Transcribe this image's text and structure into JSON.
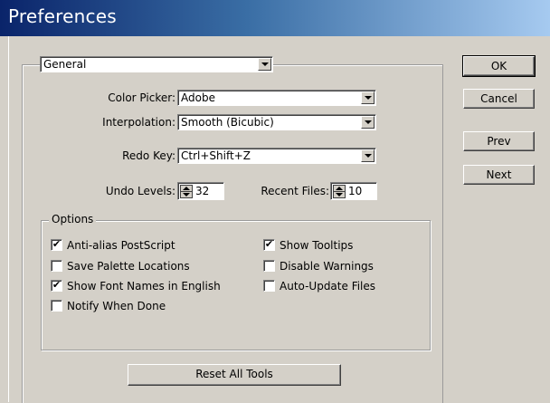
{
  "window": {
    "title": "Preferences"
  },
  "panel_select": {
    "value": "General"
  },
  "fields": {
    "color_picker": {
      "label": "Color Picker:",
      "value": "Adobe"
    },
    "interpolation": {
      "label": "Interpolation:",
      "value": "Smooth (Bicubic)"
    },
    "redo_key": {
      "label": "Redo Key:",
      "value": "Ctrl+Shift+Z"
    },
    "undo_levels": {
      "label": "Undo Levels:",
      "value": "32"
    },
    "recent_files": {
      "label": "Recent Files:",
      "value": "10"
    }
  },
  "options": {
    "legend": "Options",
    "items": [
      {
        "label": "Anti-alias PostScript",
        "checked": true
      },
      {
        "label": "Save Palette Locations",
        "checked": false
      },
      {
        "label": "Show Font Names in English",
        "checked": true
      },
      {
        "label": "Notify When Done",
        "checked": false
      },
      {
        "label": "Show Tooltips",
        "checked": true
      },
      {
        "label": "Disable Warnings",
        "checked": false
      },
      {
        "label": "Auto-Update Files",
        "checked": false
      }
    ]
  },
  "buttons": {
    "reset": "Reset All Tools",
    "ok": "OK",
    "cancel": "Cancel",
    "prev": "Prev",
    "next": "Next"
  },
  "glyphs": {
    "check": "✔"
  }
}
